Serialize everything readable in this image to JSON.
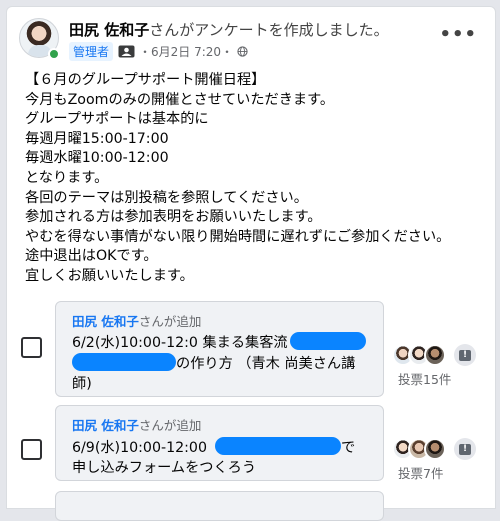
{
  "post": {
    "author": "田尻 佐和子",
    "action": "さんがアンケートを作成しました。",
    "role_badge": "管理者",
    "date": "・6月2日 7:20・",
    "more_label": "•••",
    "body_lines": [
      "【６月のグループサポート開催日程】",
      "今月もZoomのみの開催とさせていただきます。",
      "グループサポートは基本的に",
      "毎週月曜15:00-17:00",
      "毎週水曜10:00-12:00",
      "となります。",
      "各回のテーマは別投稿を参照してください。",
      "参加される方は参加表明をお願いいたします。",
      "やむを得ない事情がない限り開始時間に遅れずにご参加ください。",
      "途中退出はOKです。",
      "宜しくお願いいたします。"
    ]
  },
  "poll": {
    "options": [
      {
        "added_by": "田尻 佐和子",
        "added_suffix": "さんが追加",
        "line1_prefix": "6/2(水)10:00-12:0 集まる集客流",
        "line2_suffix": "の作り方 （青木 尚美さん講",
        "line3": "師)",
        "votes": "投票15件"
      },
      {
        "added_by": "田尻 佐和子",
        "added_suffix": "さんが追加",
        "line1_prefix": "6/9(水)10:00-12:00",
        "line1_suffix": "で",
        "line2": "申し込みフォームをつくろう",
        "votes": "投票7件"
      }
    ]
  },
  "icons": {
    "more": "more-options-icon",
    "group_badge": "group-badge-icon",
    "privacy": "globe-icon",
    "alert": "alert-icon"
  },
  "colors": {
    "accent": "#1877f2",
    "redaction": "#0a84ff",
    "online": "#31a24c"
  }
}
